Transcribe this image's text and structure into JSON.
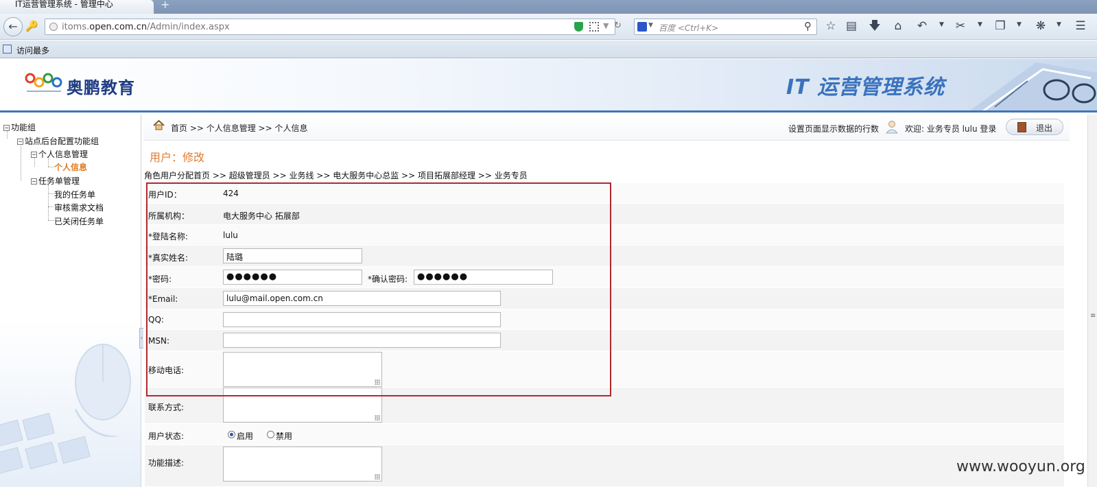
{
  "browser": {
    "tab_title": "IT运营管理系统 - 管理中心",
    "new_tab_symbol": "+",
    "url_host": "itoms.",
    "url_domain": "open.com.cn",
    "url_path": "/Admin/index.aspx",
    "search_placeholder": "百度 <Ctrl+K>",
    "bookmark_label": "访问最多"
  },
  "header": {
    "brand_name": "奥鹏教育",
    "system_title": "IT 运营管理系统"
  },
  "tree": {
    "root": "功能组",
    "group": "站点后台配置功能组",
    "personal_mgmt": "个人信息管理",
    "personal_info": "个人信息",
    "task_mgmt": "任务单管理",
    "my_tasks": "我的任务单",
    "review_docs": "审核需求文档",
    "closed_tasks": "已关闭任务单"
  },
  "topbar": {
    "breadcrumb": "首页 >> 个人信息管理 >> 个人信息",
    "rows_setting": "设置页面显示数据的行数",
    "welcome": "欢迎: 业务专员 lulu 登录",
    "logout_label": "退出"
  },
  "page": {
    "heading": "用户：修改",
    "role_path": "角色用户分配首页 >> 超级管理员 >> 业务线 >> 电大服务中心总监 >> 项目拓展部经理 >> 业务专员"
  },
  "form": {
    "user_id_label": "用户ID：",
    "user_id_value": "424",
    "org_label": "所属机构：",
    "org_value": "电大服务中心 拓展部",
    "login_label": "*登陆名称:",
    "login_value": "lulu",
    "realname_label": "*真实姓名:",
    "realname_value": "陆璐",
    "password_label": "*密码:",
    "password_value": "●●●●●●",
    "confirm_label": "*确认密码:",
    "confirm_value": "●●●●●●",
    "email_label": "*Email:",
    "email_value": "lulu@mail.open.com.cn",
    "qq_label": "QQ:",
    "qq_value": "",
    "msn_label": "MSN:",
    "msn_value": "",
    "mobile_label": "移动电话:",
    "contact_label": "联系方式:",
    "status_label": "用户状态:",
    "status_enabled": "启用",
    "status_disabled": "禁用",
    "status_selected": "启用",
    "desc_label": "功能描述:"
  },
  "watermark": "www.wooyun.org",
  "colors": {
    "accent_orange": "#e27b2b",
    "header_blue": "#3f74b8",
    "highlight_red": "#b3282d"
  }
}
